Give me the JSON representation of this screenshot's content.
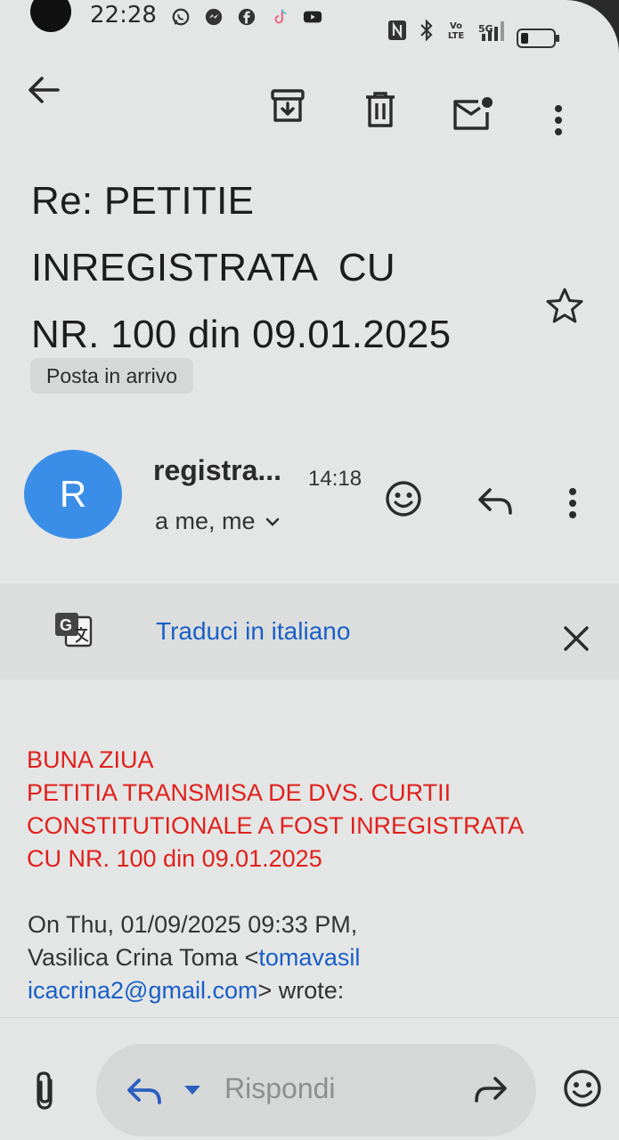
{
  "status_bar": {
    "time": "22:28",
    "network": "5G",
    "lte": "Vo LTE"
  },
  "toolbar": {
    "back_icon": "arrow-left-icon",
    "archive_icon": "archive-icon",
    "delete_icon": "trash-icon",
    "mark_unread_icon": "mail-unread-icon",
    "more_icon": "more-vert-icon"
  },
  "subject": {
    "line1": "Re: PETITIE",
    "line2": "INREGISTRATA  CU",
    "line3": "NR. 100 din 09.01.2025"
  },
  "label": "Posta in arrivo",
  "sender": {
    "avatar_letter": "R",
    "name": "registra...",
    "time": "14:18",
    "recipients": "a me, me"
  },
  "translate": {
    "label": "Traduci in italiano"
  },
  "body": {
    "lines": [
      "BUNA ZIUA",
      "PETITIA TRANSMISA DE DVS. CURTII",
      "CONSTITUTIONALE A FOST INREGISTRATA",
      "CU NR. 100 din 09.01.2025"
    ],
    "quote_line1": "On Thu, 01/09/2025 09:33 PM,",
    "quote_name": "Vasilica Crina Toma <",
    "quote_email_part1": "tomavasil",
    "quote_email_part2": "icacrina2@gmail.com",
    "quote_suffix": "> wrote:"
  },
  "reply_bar": {
    "placeholder": "Rispondi"
  },
  "colors": {
    "accent_blue": "#1a5fc7",
    "avatar": "#3b8ee8",
    "body_red": "#e0201c"
  }
}
